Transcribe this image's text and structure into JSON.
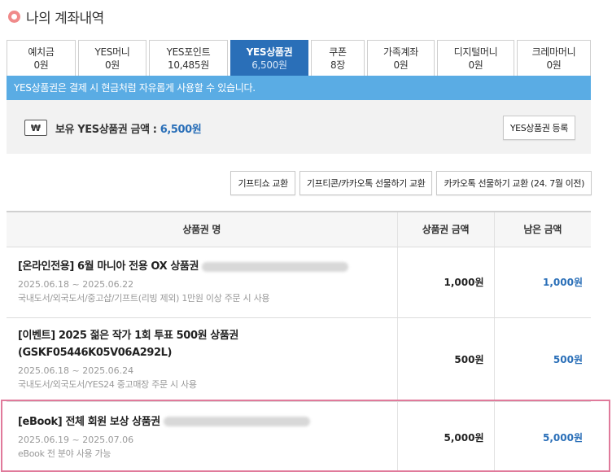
{
  "header": {
    "title": "나의 계좌내역"
  },
  "tabs": [
    {
      "label": "예치금",
      "value": "0원",
      "active": false
    },
    {
      "label": "YES머니",
      "value": "0원",
      "active": false
    },
    {
      "label": "YES포인트",
      "value": "10,485원",
      "active": false
    },
    {
      "label": "YES상품권",
      "value": "6,500원",
      "active": true
    },
    {
      "label": "쿠폰",
      "value": "8장",
      "active": false
    },
    {
      "label": "가족계좌",
      "value": "0원",
      "active": false
    },
    {
      "label": "디지털머니",
      "value": "0원",
      "active": false
    },
    {
      "label": "크레마머니",
      "value": "0원",
      "active": false
    }
  ],
  "notice": "YES상품권은 결제 시 현금처럼 자유롭게 사용할 수 있습니다.",
  "balance": {
    "icon_glyph": "₩",
    "label": "보유 YES상품권 금액 : ",
    "value": "6,500원",
    "register_button": "YES상품권 등록"
  },
  "exchange_buttons": [
    "기프티쇼 교환",
    "기프티콘/카카오톡 선물하기 교환",
    "카카오톡 선물하기 교환 (24. 7월 이전)"
  ],
  "table": {
    "headers": [
      "상품권 명",
      "상품권 금액",
      "남은 금액"
    ],
    "rows": [
      {
        "name": "[온라인전용] 6월 마니아 전용 OX 상품권",
        "date": "2025.06.18 ~ 2025.06.22",
        "desc": "국내도서/외국도서/중고샵/기프트(리빙 제외) 1만원 이상 주문 시 사용",
        "amount": "1,000원",
        "remaining": "1,000원"
      },
      {
        "name": "[이벤트] 2025 젊은 작가 1회 투표 500원 상품권 (GSKF05446K05V06A292L)",
        "date": "2025.06.18 ~ 2025.06.24",
        "desc": "국내도서/외국도서/YES24 중고매장 주문 시 사용",
        "amount": "500원",
        "remaining": "500원"
      },
      {
        "name": "[eBook] 전체 회원 보상 상품권",
        "date": "2025.06.19 ~ 2025.07.06",
        "desc": "eBook 전 분야 사용 가능",
        "amount": "5,000원",
        "remaining": "5,000원"
      }
    ]
  },
  "colors": {
    "accent": "#2a6fb8",
    "notice_bg": "#5aace4",
    "highlight": "#e07a9b"
  }
}
